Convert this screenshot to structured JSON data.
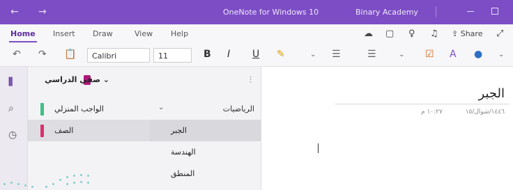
{
  "window": {
    "title": "OneNote for Windows 10",
    "account": "Binary Academy"
  },
  "menu": {
    "tabs": [
      "Home",
      "Insert",
      "Draw",
      "View",
      "Help"
    ],
    "active_tab": "Home",
    "share_label": "Share"
  },
  "toolbar": {
    "font_name": "Calibri",
    "font_size": "11",
    "bold": "B",
    "italic": "I",
    "underline": "U"
  },
  "notebook": {
    "name": "صفي الدراسي",
    "sections": [
      {
        "label": "الواجب المنزلي",
        "color": "#3fbf86"
      },
      {
        "label": "الصف",
        "color": "#d6336c"
      }
    ],
    "section_group": "الرياضيات",
    "pages": [
      "الجبر",
      "الهندسة",
      "المنطق"
    ],
    "active_page": "الجبر"
  },
  "page": {
    "title": "الجبر",
    "date": "١٤٤٦/شوال/١٥",
    "time": "١٠:٢٧ م"
  },
  "colors": {
    "accent": "#7c4dc4",
    "section_green": "#3fbf86",
    "section_pink": "#d6336c",
    "notebook_icon": "#b0187a"
  }
}
